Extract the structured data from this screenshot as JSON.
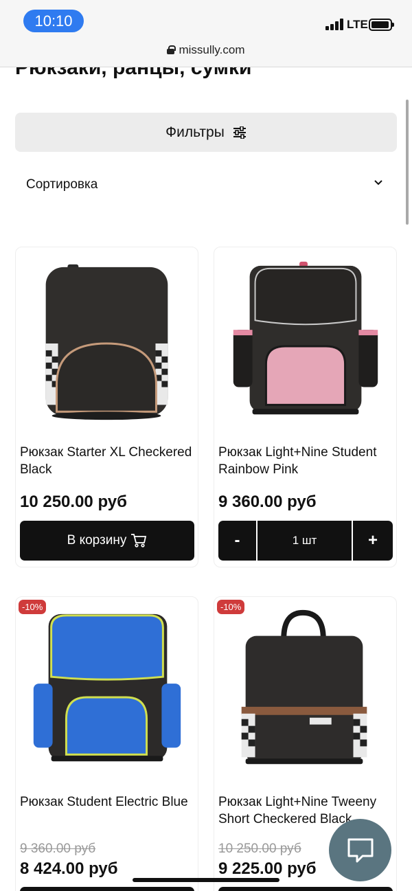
{
  "status": {
    "time": "10:10",
    "network": "LTE"
  },
  "browser": {
    "url": "missully.com"
  },
  "page": {
    "title": "Рюкзаки, ранцы, сумки",
    "filters_label": "Фильтры",
    "sort_label": "Сортировка"
  },
  "products": [
    {
      "name": "Рюкзак Starter XL Checkered Black",
      "price": "10 250.00 руб",
      "button": "В корзину"
    },
    {
      "name": "Рюкзак Light+Nine Student Rainbow Pink",
      "price": "9 360.00 руб",
      "qty": {
        "minus": "-",
        "value": "1 шт",
        "plus": "+"
      }
    },
    {
      "name": "Рюкзак Student Electric Blue",
      "badge": "-10%",
      "old_price": "9 360.00 руб",
      "price": "8 424.00 руб"
    },
    {
      "name": "Рюкзак Light+Nine Tweeny Short Checkered Black",
      "badge": "-10%",
      "old_price": "10 250.00 руб",
      "price": "9 225.00 руб"
    }
  ],
  "colors": {
    "accent_blue": "#2f7bf0",
    "button_dark": "#111111",
    "badge_red": "#cf3b3b",
    "chat_bubble": "#5a7580"
  }
}
